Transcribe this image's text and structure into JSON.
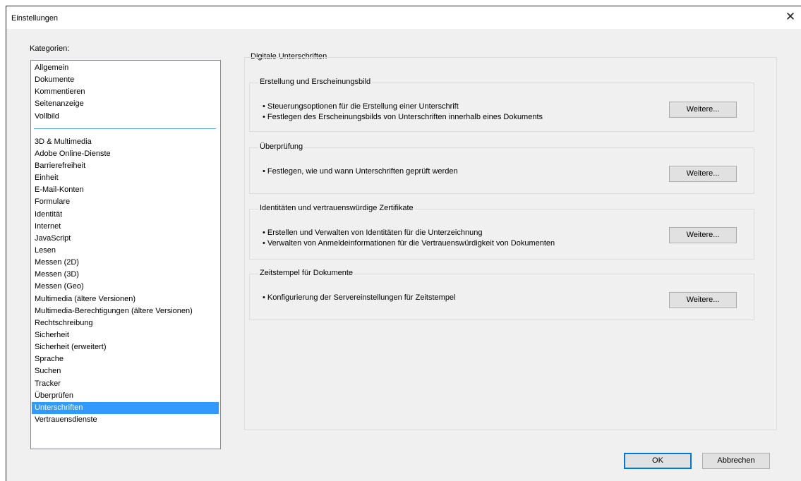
{
  "window": {
    "title": "Einstellungen",
    "close": "✕"
  },
  "categories": {
    "label": "Kategorien:",
    "top_items": [
      "Allgemein",
      "Dokumente",
      "Kommentieren",
      "Seitenanzeige",
      "Vollbild"
    ],
    "items": [
      "3D & Multimedia",
      "Adobe Online-Dienste",
      "Barrierefreiheit",
      "Einheit",
      "E-Mail-Konten",
      "Formulare",
      "Identität",
      "Internet",
      "JavaScript",
      "Lesen",
      "Messen (2D)",
      "Messen (3D)",
      "Messen (Geo)",
      "Multimedia (ältere Versionen)",
      "Multimedia-Berechtigungen (ältere Versionen)",
      "Rechtschreibung",
      "Sicherheit",
      "Sicherheit (erweitert)",
      "Sprache",
      "Suchen",
      "Tracker",
      "Überprüfen",
      "Unterschriften",
      "Vertrauensdienste"
    ],
    "selected": "Unterschriften"
  },
  "main": {
    "title": "Digitale Unterschriften",
    "groups": [
      {
        "title": "Erstellung und Erscheinungsbild",
        "bullets": [
          "• Steuerungsoptionen für die Erstellung einer Unterschrift",
          "• Festlegen des Erscheinungsbilds von Unterschriften innerhalb eines Dokuments"
        ],
        "button": "Weitere..."
      },
      {
        "title": "Überprüfung",
        "bullets": [
          "• Festlegen, wie und wann Unterschriften geprüft werden"
        ],
        "button": "Weitere..."
      },
      {
        "title": "Identitäten und vertrauenswürdige Zertifikate",
        "bullets": [
          "• Erstellen und Verwalten von Identitäten für die Unterzeichnung",
          "• Verwalten von Anmeldeinformationen für die Vertrauenswürdigkeit von Dokumenten"
        ],
        "button": "Weitere..."
      },
      {
        "title": "Zeitstempel für Dokumente",
        "bullets": [
          "• Konfigurierung der Servereinstellungen für Zeitstempel"
        ],
        "button": "Weitere..."
      }
    ]
  },
  "footer": {
    "ok": "OK",
    "cancel": "Abbrechen"
  }
}
